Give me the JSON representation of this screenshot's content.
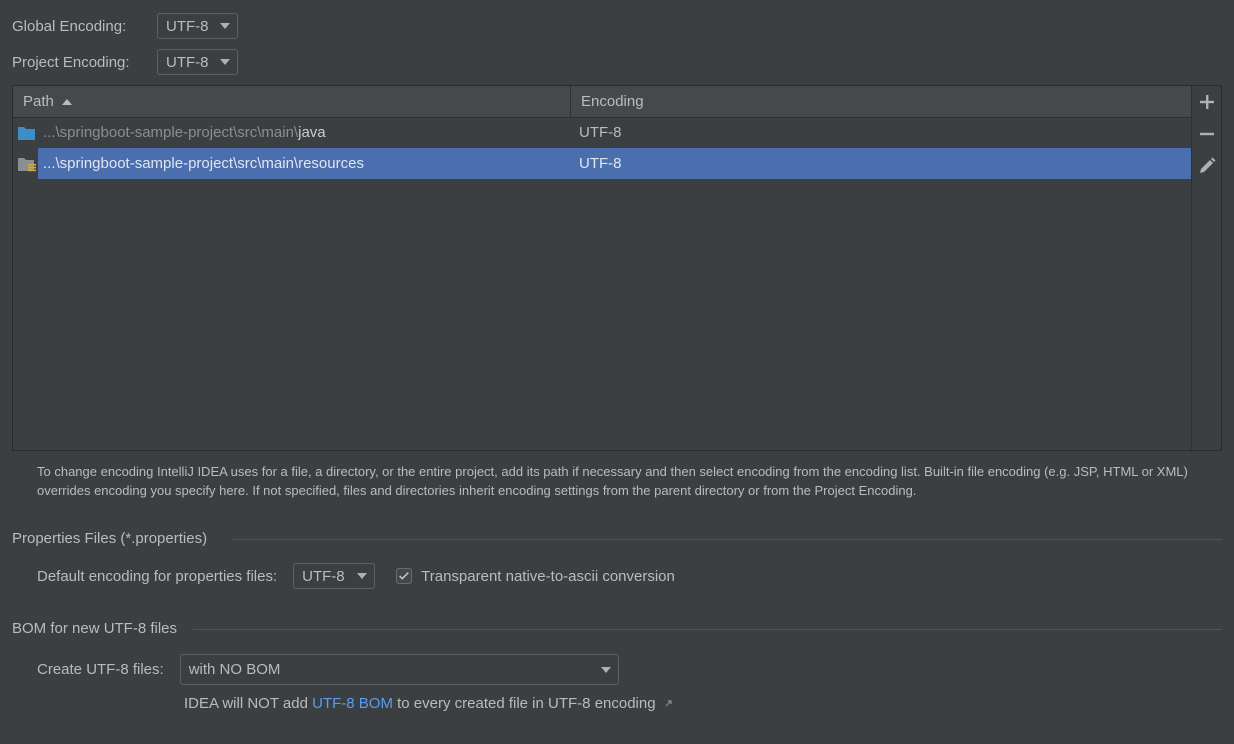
{
  "global_encoding": {
    "label": "Global Encoding:",
    "value": "UTF-8"
  },
  "project_encoding": {
    "label": "Project Encoding:",
    "value": "UTF-8"
  },
  "table": {
    "columns": {
      "path": "Path",
      "encoding": "Encoding"
    },
    "rows": [
      {
        "path_prefix": "...\\springboot-sample-project\\src\\main\\",
        "path_last": "java",
        "encoding": "UTF-8",
        "icon": "source-folder-icon",
        "selected": false
      },
      {
        "path_prefix": "...\\springboot-sample-project\\src\\main\\resources",
        "path_last": "",
        "encoding": "UTF-8",
        "icon": "resources-folder-icon",
        "selected": true
      }
    ],
    "toolbar": {
      "add": "add-icon",
      "remove": "remove-icon",
      "edit": "edit-icon"
    }
  },
  "help_text": "To change encoding IntelliJ IDEA uses for a file, a directory, or the entire project, add its path if necessary and then select encoding from the encoding list. Built-in file encoding (e.g. JSP, HTML or XML) overrides encoding you specify here. If not specified, files and directories inherit encoding settings from the parent directory or from the Project Encoding.",
  "properties": {
    "section_title": "Properties Files (*.properties)",
    "default_label": "Default encoding for properties files:",
    "default_value": "UTF-8",
    "native_to_ascii_label": "Transparent native-to-ascii conversion",
    "native_to_ascii_checked": true
  },
  "bom": {
    "section_title": "BOM for new UTF-8 files",
    "create_label": "Create UTF-8 files:",
    "create_value": "with NO BOM",
    "note_prefix": "IDEA will NOT add ",
    "note_link": "UTF-8 BOM",
    "note_suffix": " to every created file in UTF-8 encoding"
  },
  "colors": {
    "background": "#3c3f41",
    "selection": "#4b6eaf",
    "link": "#589df6",
    "folder_blue": "#3d8dc8"
  }
}
